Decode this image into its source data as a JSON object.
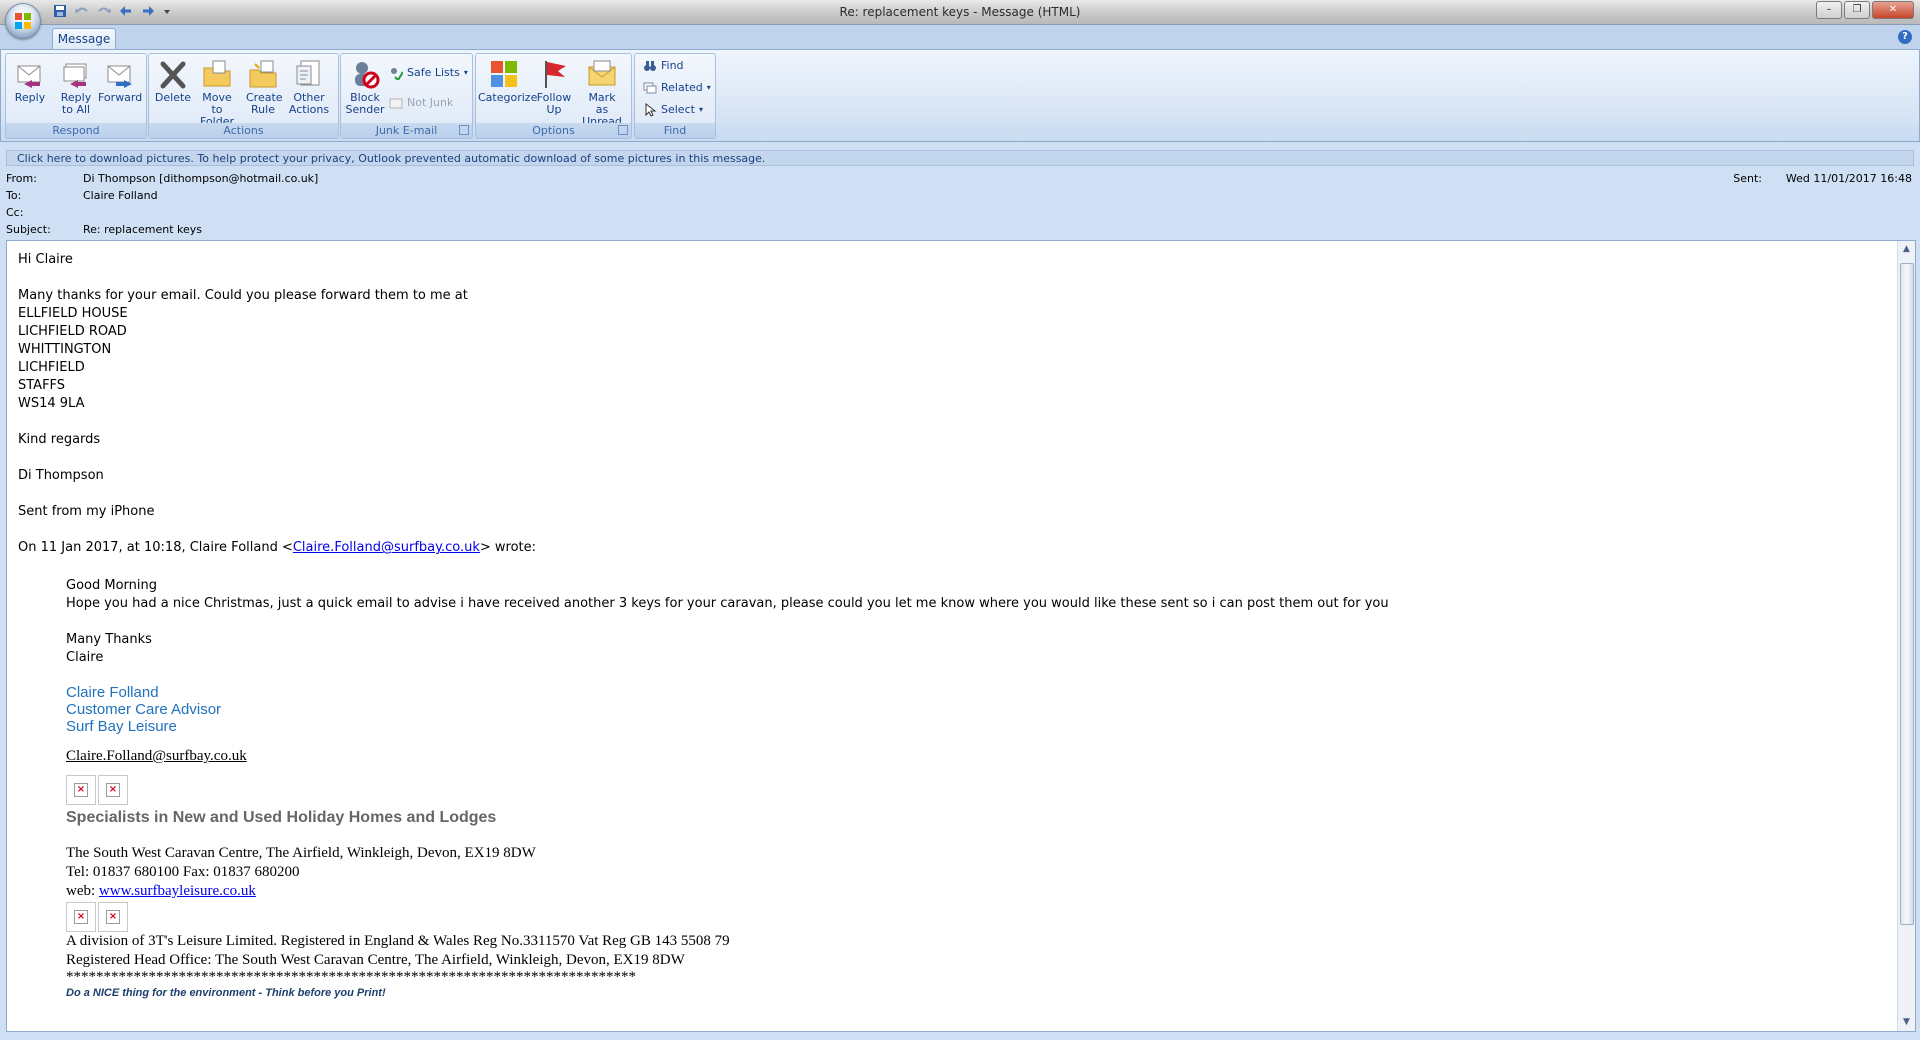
{
  "window": {
    "title": "Re: replacement keys - Message (HTML)",
    "controls": {
      "minimize": "–",
      "restore": "❐",
      "close": "✕"
    }
  },
  "tabs": [
    {
      "label": "Message"
    }
  ],
  "help": {
    "glyph": "?"
  },
  "ribbon": {
    "groups": [
      {
        "label": "Respond",
        "buttons": [
          {
            "label": "Reply",
            "icon": "reply-icon"
          },
          {
            "label": "Reply to All",
            "icon": "reply-all-icon"
          },
          {
            "label": "Forward",
            "icon": "forward-icon"
          }
        ]
      },
      {
        "label": "Actions",
        "buttons": [
          {
            "label": "Delete",
            "icon": "delete-icon"
          },
          {
            "label": "Move to Folder",
            "icon": "move-folder-icon"
          },
          {
            "label": "Create Rule",
            "icon": "create-rule-icon"
          },
          {
            "label": "Other Actions",
            "icon": "other-actions-icon"
          }
        ]
      },
      {
        "label": "Junk E-mail",
        "buttons": [
          {
            "label": "Block Sender",
            "icon": "block-sender-icon"
          },
          {
            "label": "Safe Lists",
            "icon": "safe-lists-icon"
          },
          {
            "label": "Not Junk",
            "icon": "not-junk-icon"
          }
        ]
      },
      {
        "label": "Options",
        "buttons": [
          {
            "label": "Categorize",
            "icon": "categorize-icon"
          },
          {
            "label": "Follow Up",
            "icon": "follow-up-flag-icon"
          },
          {
            "label": "Mark as Unread",
            "icon": "mark-unread-icon"
          }
        ]
      },
      {
        "label": "Find",
        "buttons": [
          {
            "label": "Find",
            "icon": "binoculars-icon"
          },
          {
            "label": "Related",
            "icon": "related-icon"
          },
          {
            "label": "Select",
            "icon": "select-cursor-icon"
          }
        ]
      }
    ]
  },
  "infobar": {
    "text": "Click here to download pictures. To help protect your privacy, Outlook prevented automatic download of some pictures in this message."
  },
  "header": {
    "from_label": "From:",
    "from": "Di Thompson [dithompson@hotmail.co.uk]",
    "to_label": "To:",
    "to": "Claire Folland",
    "cc_label": "Cc:",
    "cc": "",
    "subject_label": "Subject:",
    "subject": "Re: replacement keys",
    "sent_label": "Sent:",
    "sent": "Wed 11/01/2017 16:48"
  },
  "body": {
    "greeting": "Hi Claire",
    "line1": "Many thanks for your email. Could you please forward them to me at",
    "address": [
      "ELLFIELD HOUSE",
      "LICHFIELD ROAD",
      "WHITTINGTON",
      "LICHFIELD",
      "STAFFS",
      "WS14 9LA"
    ],
    "regards": "Kind regards",
    "name": "Di Thompson",
    "sent_from": "Sent from my iPhone",
    "quote_intro_before": "On 11 Jan 2017, at 10:18, Claire Folland <",
    "quote_intro_link": "Claire.Folland@surfbay.co.uk",
    "quote_intro_after": "> wrote:"
  },
  "quoted": {
    "greeting": "Good Morning",
    "line1": "Hope you had a nice Christmas, just a quick email to advise i have received another 3 keys for your caravan, please could you let me know where you would like these sent so i can post them out for you",
    "thanks": "Many Thanks",
    "name": "Claire",
    "sig_name": "Claire Folland",
    "sig_title": "Customer Care Advisor",
    "sig_company": "Surf Bay Leisure",
    "sig_email": "Claire.Folland@surfbay.co.uk",
    "specialists": "Specialists in New and Used Holiday Homes and Lodges",
    "address": "The South West Caravan Centre, The Airfield, Winkleigh, Devon, EX19 8DW",
    "tel": "Tel: 01837 680100  Fax: 01837 680200",
    "web_label": "web: ",
    "web_link": "www.surfbayleisure.co.uk",
    "division": "A division of 3T's Leisure Limited. Registered in England & Wales Reg No.3311570  Vat Reg GB 143 5508 79",
    "head_office": "Registered Head Office: The South West Caravan Centre, The Airfield, Winkleigh, Devon, EX19 8DW",
    "stars": "****************************************************************************",
    "nice": "Do a NICE thing for the environment - Think before you Print!",
    "broken_image_glyph": "×"
  }
}
